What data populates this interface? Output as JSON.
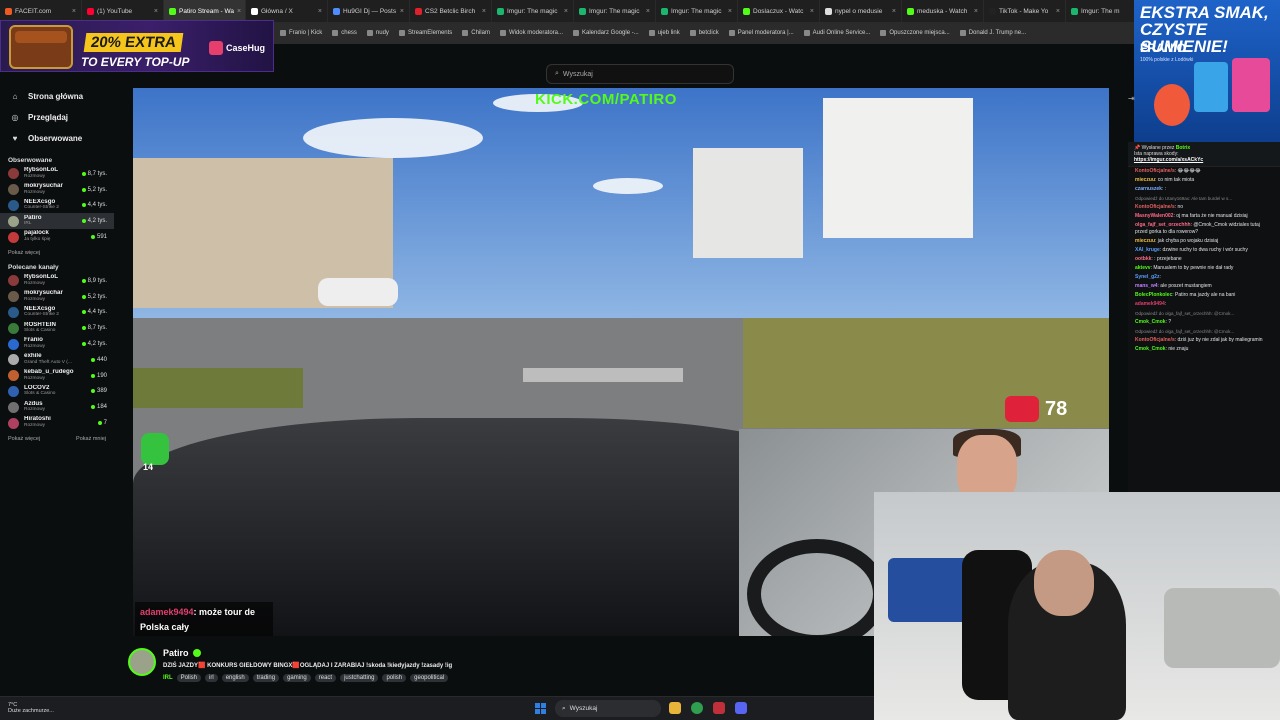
{
  "browser": {
    "tabs": [
      {
        "label": "FACEIT.com",
        "color": "#f05a22",
        "active": false
      },
      {
        "label": "(1) YouTube",
        "color": "#ff0033",
        "active": false
      },
      {
        "label": "Patiro Stream - Wa",
        "color": "#53fc18",
        "active": true
      },
      {
        "label": "Główna / X",
        "color": "#ffffff",
        "active": false
      },
      {
        "label": "Hu9GI Dj — Posts",
        "color": "#4f8cff",
        "active": false
      },
      {
        "label": "CS2 Betclic Birch",
        "color": "#e0202a",
        "active": false
      },
      {
        "label": "Imgur: The magic",
        "color": "#1bb76e",
        "active": false
      },
      {
        "label": "Imgur: The magic",
        "color": "#1bb76e",
        "active": false
      },
      {
        "label": "Imgur: The magic",
        "color": "#1bb76e",
        "active": false
      },
      {
        "label": "Doslaczux - Watc",
        "color": "#53fc18",
        "active": false
      },
      {
        "label": "nypel o medusie",
        "color": "#dddddd",
        "active": false
      },
      {
        "label": "meduska - Watch",
        "color": "#53fc18",
        "active": false
      },
      {
        "label": "TikTok - Make Yo",
        "color": "#222222",
        "active": false
      },
      {
        "label": "Imgur: The m",
        "color": "#1bb76e",
        "active": false
      }
    ],
    "bookmarks": [
      "Franio | Kick",
      "chess",
      "nudy",
      "StreamElements",
      "Chilam",
      "Widok moderatora...",
      "Kalendarz Google -...",
      "ujeb link",
      "betclick",
      "Panel moderatora |...",
      "Audi Online Service...",
      "Opuszczone miejsca...",
      "Donald J. Trump ne..."
    ]
  },
  "ads": {
    "casehug_promo": "20% EXTRA",
    "casehug_sub": "TO EVERY TOP-UP",
    "casehug_brand": "CaseHug",
    "franio_headline": "EKSTRA SMAK, CZYSTE SUMIENIE!",
    "franio_brand": "FRANIO",
    "franio_small": "100% polskie z Lodówki"
  },
  "search": {
    "placeholder": "Wyszukaj"
  },
  "nav": [
    {
      "label": "Strona główna",
      "icon": "home-icon",
      "glyph": "⌂"
    },
    {
      "label": "Przeglądaj",
      "icon": "compass-icon",
      "glyph": "◎"
    },
    {
      "label": "Obserwowane",
      "icon": "heart-icon",
      "glyph": "♥"
    }
  ],
  "followed": {
    "title": "Obserwowane",
    "channels": [
      {
        "name": "RybsonLoL",
        "category": "Rozmowy",
        "viewers": "8,7 tys.",
        "color": "#8a3a3a",
        "selected": false
      },
      {
        "name": "mokrysuchar",
        "category": "Rozmowy",
        "viewers": "5,2 tys.",
        "color": "#6a5a4a",
        "selected": false
      },
      {
        "name": "NEEXcsgo",
        "category": "Counter-Strike 2",
        "viewers": "4,4 tys.",
        "color": "#2a5a8a",
        "selected": false
      },
      {
        "name": "Patiro",
        "category": "IRL",
        "viewers": "4,2 tys.",
        "color": "#9aa38a",
        "selected": true
      },
      {
        "name": "pajalock",
        "category": "Ja tylko śpię",
        "viewers": "591",
        "color": "#c23a3a",
        "selected": false
      }
    ],
    "more": "Pokaż więcej"
  },
  "recommended": {
    "title": "Polecane kanały",
    "channels": [
      {
        "name": "RybsonLoL",
        "category": "Rozmowy",
        "viewers": "8,9 tys.",
        "color": "#8a3a3a"
      },
      {
        "name": "mokrysuchar",
        "category": "Rozmowy",
        "viewers": "5,2 tys.",
        "color": "#6a5a4a"
      },
      {
        "name": "NEEXcsgo",
        "category": "Counter-Strike 2",
        "viewers": "4,4 tys.",
        "color": "#2a5a8a"
      },
      {
        "name": "ROSHTEIN",
        "category": "Slots & Casino",
        "viewers": "8,7 tys.",
        "color": "#3a7a3a"
      },
      {
        "name": "Franio",
        "category": "Rozmowy",
        "viewers": "4,2 tys.",
        "color": "#2a6ad0"
      },
      {
        "name": "exhile",
        "category": "Grand Theft Auto V (...",
        "viewers": "440",
        "color": "#aaaaaa"
      },
      {
        "name": "kebab_u_rudego",
        "category": "Rozmowy",
        "viewers": "190",
        "color": "#c06030"
      },
      {
        "name": "LOCOV2",
        "category": "Slots & Casino",
        "viewers": "389",
        "color": "#3060b0"
      },
      {
        "name": "Azdus",
        "category": "Rozmowy",
        "viewers": "184",
        "color": "#707070"
      },
      {
        "name": "Hiratoshi",
        "category": "Rozmowy",
        "viewers": "7",
        "color": "#b04060"
      }
    ],
    "more": "Pokaż więcej",
    "less": "Pokaż mniej"
  },
  "video": {
    "overlay_url": "KICK.COM/PATIRO",
    "heart_rate": "78",
    "emote_text": "14",
    "caption_user": "adamek9494",
    "caption_text": ": może tour de Polska cały"
  },
  "stream": {
    "name": "Patiro",
    "title": "DZIŚ JAZDY🟥 KONKURS GIEŁDOWY BINGX🟥OGLĄDAJ I ZARABIAJ !skoda !kiedyjazdy !zasady !ig",
    "tags": [
      "IRL",
      "Polish",
      "irl",
      "english",
      "trading",
      "gaming",
      "react",
      "justchatting",
      "polish",
      "geopolitical"
    ]
  },
  "chat": {
    "pinned_label": "Wysłane przez",
    "pinned_user": "Botrix",
    "pinned_text": "Ista naprawa skody:",
    "pinned_link": "https://imgur.com/a/xsACkYc",
    "messages": [
      {
        "user": "KontoOficjalne/s",
        "color": "#e86060",
        "text": "😂😂😂😂",
        "reply": ""
      },
      {
        "user": "mieczuu",
        "color": "#f0c040",
        "text": "co nim tak miota",
        "reply": ""
      },
      {
        "user": "czarnuszek",
        "color": "#80b0ff",
        "text": ":",
        "reply": ""
      },
      {
        "user": "KontoOficjalne/s",
        "color": "#e86060",
        "text": "no",
        "reply": "Odpowiedź do Utany169ax: Ale tam burdel w s..."
      },
      {
        "user": "MasnyWalen002",
        "color": "#ff6a8a",
        "text": "oj ma farta że nie manual dzisiaj",
        "reply": ""
      },
      {
        "user": "olga_fajf_set_orzechhh",
        "color": "#ff6a8a",
        "text": "@Cmok_Cmok widziales tutaj przed gorka to dla rowerow?",
        "reply": ""
      },
      {
        "user": "mieczuu",
        "color": "#f0c040",
        "text": "jak chyba po wojaku dzisiaj",
        "reply": ""
      },
      {
        "user": "XAI_kruge",
        "color": "#5aa0ff",
        "text": "dzwine ruchy to dwa ruchy i wór suchy",
        "reply": ""
      },
      {
        "user": "ootbkk",
        "color": "#ff6a8a",
        "text": ": przejebane",
        "reply": ""
      },
      {
        "user": "aktevv",
        "color": "#53fc18",
        "text": "Manualem to by pewnie nie dał rady",
        "reply": ""
      },
      {
        "user": "Synel_g2z",
        "color": "#5aa0ff",
        "text": "",
        "reply": ""
      },
      {
        "user": "mans_w4",
        "color": "#c080ff",
        "text": "ale poszet mustangiem",
        "reply": ""
      },
      {
        "user": "BolecPlonkolec",
        "color": "#53fc18",
        "text": "Patiro ma jazdy ale na bani",
        "reply": ""
      },
      {
        "user": "adamek9494",
        "color": "#e23f6f",
        "text": "",
        "reply": ""
      },
      {
        "user": "Cmok_Cmok",
        "color": "#53fc18",
        "text": "?",
        "reply": "Odpowiedź do olga_fajf_set_orzechhh: @Cmok..."
      },
      {
        "user": "KontoOficjalne/s",
        "color": "#e86060",
        "text": "dziś juz by nie zdał jak by maliegramin",
        "reply": "Odpowiedź do olga_fajf_set_orzechhh: @Cmok..."
      },
      {
        "user": "Cmok_Cmok",
        "color": "#53fc18",
        "text": "nie znaju",
        "reply": ""
      }
    ]
  },
  "taskbar": {
    "weather_temp": "7°C",
    "weather_desc": "Duże zachmurze...",
    "search_placeholder": "Wyszukaj"
  }
}
